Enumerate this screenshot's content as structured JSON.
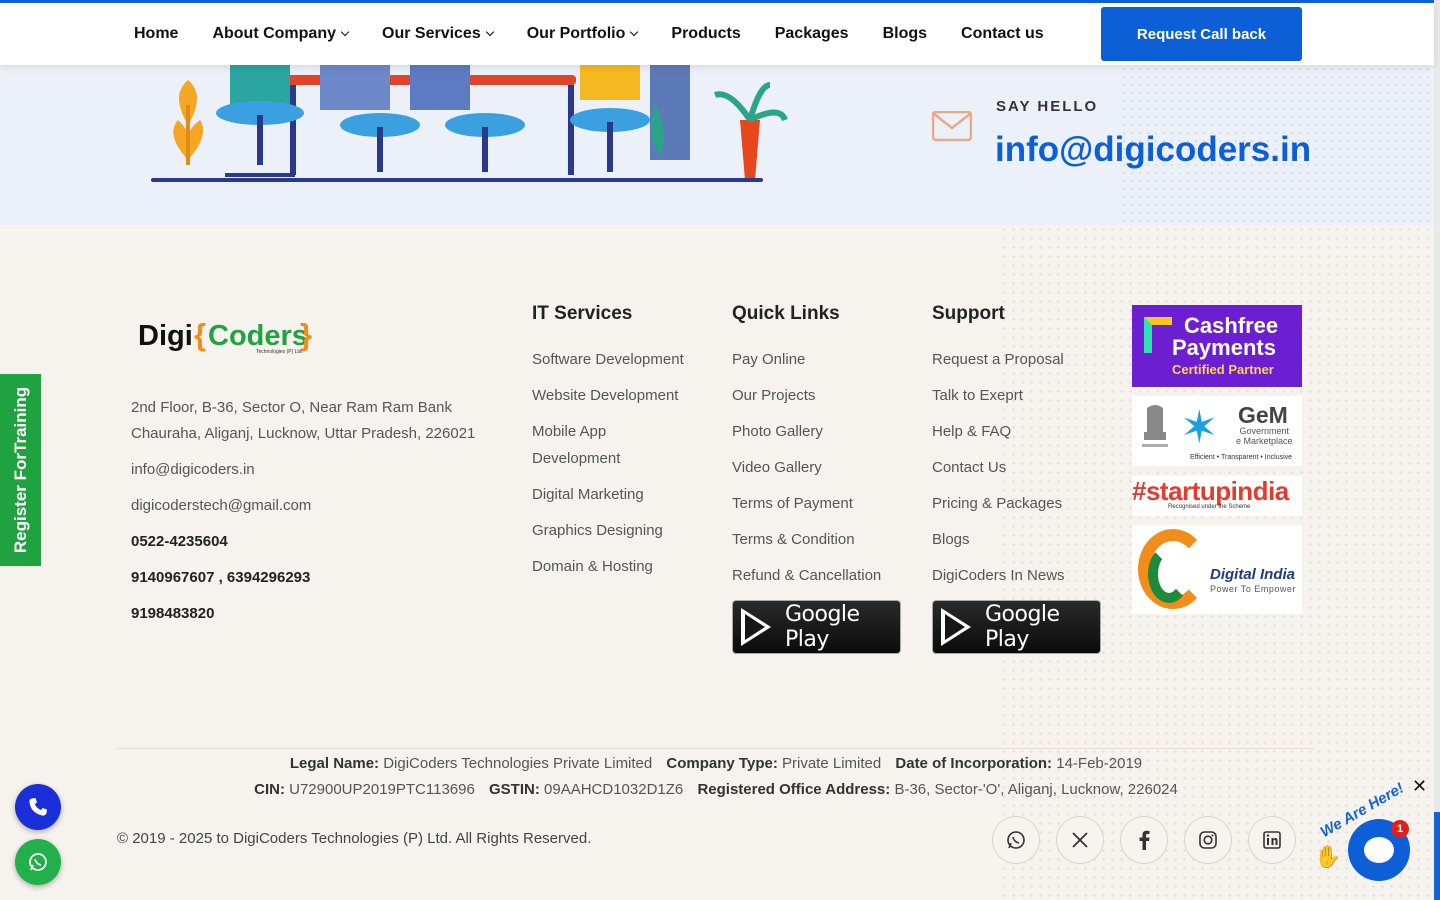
{
  "nav": {
    "items": [
      {
        "label": "Home",
        "dropdown": false
      },
      {
        "label": "About Company",
        "dropdown": true
      },
      {
        "label": "Our Services",
        "dropdown": true
      },
      {
        "label": "Our Portfolio",
        "dropdown": true
      },
      {
        "label": "Products",
        "dropdown": false
      },
      {
        "label": "Packages",
        "dropdown": false
      },
      {
        "label": "Blogs",
        "dropdown": false
      },
      {
        "label": "Contact us",
        "dropdown": false
      }
    ],
    "cta": "Request Call back"
  },
  "hero": {
    "say_hello": "SAY HELLO",
    "email": "info@digicoders.in"
  },
  "footer": {
    "brand": {
      "logo_text": "Digi{Coders}",
      "logo_sub": "Technologies (P) Ltd."
    },
    "contact": {
      "address_line1": "2nd Floor, B-36, Sector O, Near Ram Ram Bank",
      "address_line2": "Chauraha, Aliganj, Lucknow, Uttar Pradesh, 226021",
      "email1": "info@digicoders.in",
      "email2": "digicoderstech@gmail.com",
      "phone1": "0522-4235604",
      "phone2": "9140967607 , 6394296293",
      "phone3": "9198483820"
    },
    "it_services": {
      "title": "IT Services",
      "items": [
        "Software Development",
        "Website Development",
        "Mobile App",
        "Development",
        "Digital Marketing",
        "Graphics Designing",
        "Domain & Hosting"
      ]
    },
    "quick_links": {
      "title": "Quick Links",
      "items": [
        "Pay Online",
        "Our Projects",
        "Photo Gallery",
        "Video Gallery",
        "Terms of Payment",
        "Terms & Condition",
        "Refund & Cancellation"
      ]
    },
    "support": {
      "title": "Support",
      "items": [
        "Request a Proposal",
        "Talk to Exeprt",
        "Help & FAQ",
        "Contact Us",
        "Pricing & Packages",
        "Blogs",
        "DigiCoders In News"
      ]
    },
    "google_play": "Google Play",
    "badges": {
      "cashfree": {
        "line1": "Cashfree",
        "line2": "Payments",
        "line3": "Certified Partner"
      },
      "gem": {
        "title": "GeM",
        "sub1": "Government",
        "sub2": "e Marketplace",
        "tagline": "Efficient • Transparent • Inclusive"
      },
      "startup": {
        "title": "#startupindia",
        "sub": "Recognised under the Scheme"
      },
      "digital_india": {
        "title": "Digital India",
        "sub": "Power To Empower"
      }
    },
    "legal": {
      "legal_name_label": "Legal Name:",
      "legal_name": "DigiCoders Technologies Private Limited",
      "company_type_label": "Company Type:",
      "company_type": "Private Limited",
      "incorp_label": "Date of Incorporation:",
      "incorp": "14-Feb-2019",
      "cin_label": "CIN:",
      "cin": "U72900UP2019PTC113696",
      "gstin_label": "GSTIN:",
      "gstin": "09AAHCD1032D1Z6",
      "office_label": "Registered Office Address:",
      "office": "B-36, Sector-'O', Aliganj, Lucknow, 226024"
    },
    "copyright": "© 2019 - 2025 to DigiCoders Technologies (P) Ltd. All Rights Reserved.",
    "social": [
      "whatsapp-icon",
      "x-icon",
      "facebook-icon",
      "instagram-icon",
      "linkedin-icon"
    ]
  },
  "side_tab": "Register ForTraining",
  "chat": {
    "greeting": "We Are Here!",
    "unread": "1",
    "close": "✕"
  },
  "colors": {
    "brand_blue": "#0d5fd8",
    "green": "#21a240",
    "footer_bg": "#f6f3ee"
  }
}
